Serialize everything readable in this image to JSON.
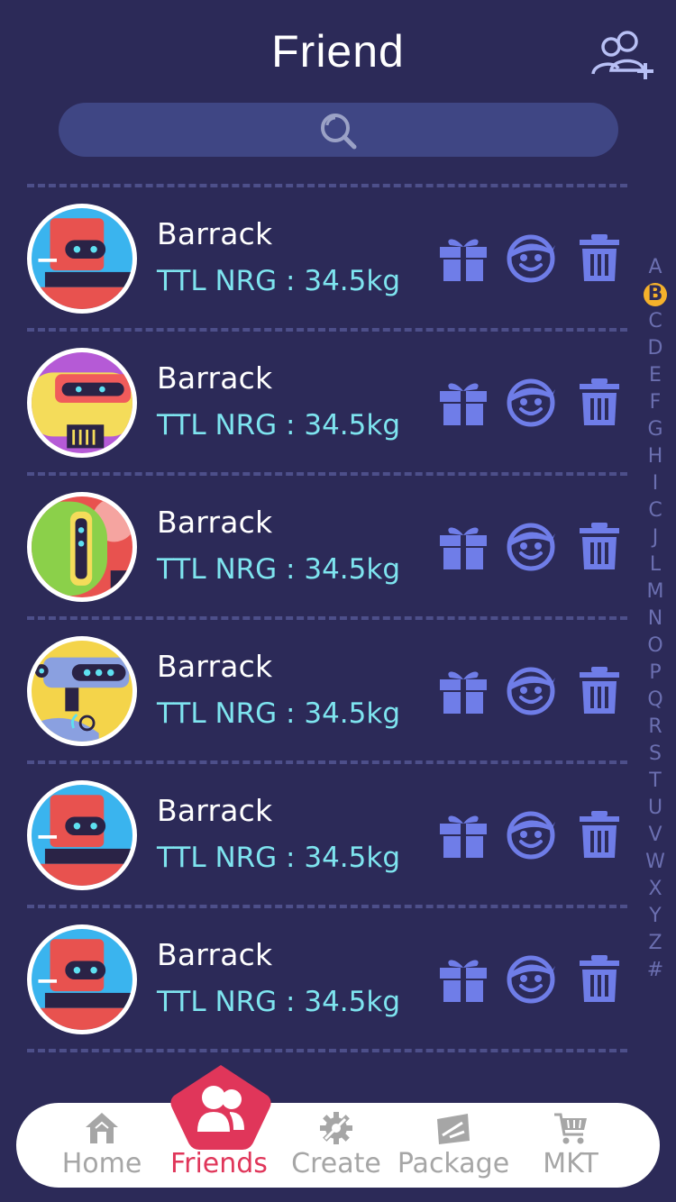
{
  "header": {
    "title": "Friend"
  },
  "search": {
    "placeholder": ""
  },
  "friends": [
    {
      "name": "Barrack",
      "energy": "TTL NRG : 34.5kg",
      "avatar": "red-robot"
    },
    {
      "name": "Barrack",
      "energy": "TTL NRG : 34.5kg",
      "avatar": "yellow-robot"
    },
    {
      "name": "Barrack",
      "energy": "TTL NRG : 34.5kg",
      "avatar": "green-robot"
    },
    {
      "name": "Barrack",
      "energy": "TTL NRG : 34.5kg",
      "avatar": "blue-robot"
    },
    {
      "name": "Barrack",
      "energy": "TTL NRG : 34.5kg",
      "avatar": "red-robot"
    },
    {
      "name": "Barrack",
      "energy": "TTL NRG : 34.5kg",
      "avatar": "red-robot"
    }
  ],
  "alphabet": [
    "A",
    "B",
    "C",
    "D",
    "E",
    "F",
    "G",
    "H",
    "I",
    "C",
    "J",
    "L",
    "M",
    "N",
    "O",
    "P",
    "Q",
    "R",
    "S",
    "T",
    "U",
    "V",
    "W",
    "X",
    "Y",
    "Z",
    "#"
  ],
  "alphabet_active": "B",
  "tabs": [
    {
      "label": "Home",
      "icon": "home-icon"
    },
    {
      "label": "Friends",
      "icon": "friends-icon"
    },
    {
      "label": "Create",
      "icon": "gear-icon"
    },
    {
      "label": "Package",
      "icon": "package-icon"
    },
    {
      "label": "MKT",
      "icon": "cart-icon"
    }
  ],
  "colors": {
    "background": "#2c2a58",
    "accent": "#e0365a",
    "energy_text": "#7ee4ef",
    "action_icons": "#6f7de8",
    "alphabet_highlight": "#f5b12b"
  }
}
